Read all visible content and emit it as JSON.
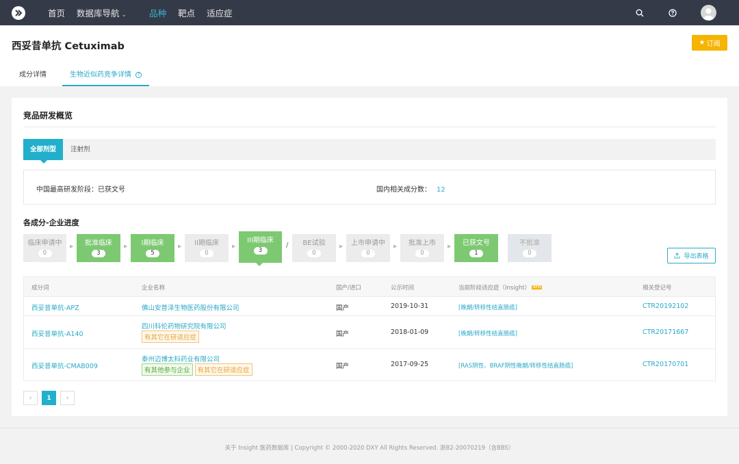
{
  "nav": {
    "items": [
      {
        "label": "首页",
        "active": false
      },
      {
        "label": "数据库导航",
        "active": false,
        "dropdown": true
      },
      {
        "label": "品种",
        "active": true
      },
      {
        "label": "靶点",
        "active": false
      },
      {
        "label": "适应症",
        "active": false
      }
    ],
    "icons": [
      "search-icon",
      "help-icon",
      "avatar"
    ]
  },
  "header": {
    "title": "西妥昔单抗 Cetuximab",
    "subscribe_label": "订阅",
    "tabs": [
      {
        "label": "成分详情",
        "active": false
      },
      {
        "label": "生物近似药竞争详情",
        "active": true
      }
    ]
  },
  "overview": {
    "title": "竞品研发概览",
    "subtabs": [
      {
        "label": "全部剂型",
        "active": true
      },
      {
        "label": "注射剂",
        "active": false
      }
    ],
    "highest_stage_label": "中国最高研发阶段：已获文号",
    "related_count_label": "国内相关成分数：",
    "related_count": "12"
  },
  "progress": {
    "title": "各成分-企业进度",
    "stages": [
      {
        "label": "临床申请中",
        "count": "0",
        "state": "gray"
      },
      {
        "label": "批准临床",
        "count": "3",
        "state": "green"
      },
      {
        "label": "I期临床",
        "count": "5",
        "state": "green"
      },
      {
        "label": "II期临床",
        "count": "0",
        "state": "gray"
      },
      {
        "label": "III期临床",
        "count": "3",
        "state": "green-active"
      },
      {
        "label": "BE试验",
        "count": "0",
        "state": "gray"
      },
      {
        "label": "上市申请中",
        "count": "0",
        "state": "gray"
      },
      {
        "label": "批准上市",
        "count": "0",
        "state": "gray"
      },
      {
        "label": "已获文号",
        "count": "1",
        "state": "green"
      },
      {
        "label": "不批准",
        "count": "0",
        "state": "gray2"
      }
    ],
    "separator": "/",
    "export_label": "导出表格"
  },
  "table": {
    "headers": [
      "成分词",
      "企业名称",
      "国产/进口",
      "公示时间",
      "当前阶段适应症（Insight）",
      "相关登记号"
    ],
    "new_badge": "NEW",
    "rows": [
      {
        "ingredient": "西妥昔单抗-APZ",
        "company": "佛山安普泽生物医药股份有限公司",
        "tags": [],
        "origin": "国产",
        "date": "2019-10-31",
        "indication": "[晚期/转移性结直肠癌]",
        "reg_no": "CTR20192102"
      },
      {
        "ingredient": "西妥昔单抗-A140",
        "company": "四川科伦药物研究院有限公司",
        "tags": [
          {
            "label": "有其它在研适应症",
            "type": "orange"
          }
        ],
        "origin": "国产",
        "date": "2018-01-09",
        "indication": "[晚期/转移性结直肠癌]",
        "reg_no": "CTR20171667"
      },
      {
        "ingredient": "西妥昔单抗-CMAB009",
        "company": "泰州迈博太科药业有限公司",
        "tags": [
          {
            "label": "有其他参与企业",
            "type": "green"
          },
          {
            "label": "有其它在研适应症",
            "type": "orange"
          }
        ],
        "origin": "国产",
        "date": "2017-09-25",
        "indication": "[RAS阴性、BRAF阴性晚期/转移性结直肠癌]",
        "reg_no": "CTR20170701"
      }
    ]
  },
  "pager": {
    "prev": "‹",
    "current": "1",
    "next": "›"
  },
  "footer": {
    "text": "关于 Insight 医药数据库  |  Copyright © 2000-2020 DXY All Rights Reserved. 浙B2-20070219（含BBS）"
  }
}
